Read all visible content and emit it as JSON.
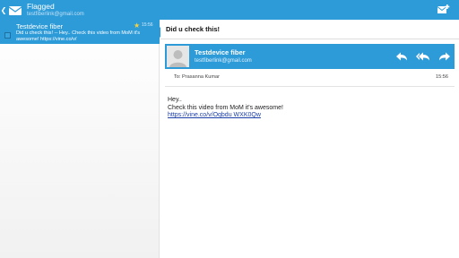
{
  "appbar": {
    "folder_title": "Flagged",
    "account_email": "testfiberlink@gmail.com",
    "back_icon": "chevron-left-icon",
    "app_icon": "envelope-icon",
    "compose_icon": "compose-mail-icon"
  },
  "message_list": {
    "items": [
      {
        "sender": "Testdevice fiber",
        "time": "15:56",
        "flagged": true,
        "snippet": "Did u check this! -- Hey.. Check this video from MoM it's awesome! https://vine.co/v/"
      }
    ]
  },
  "reader": {
    "subject": "Did u check this!",
    "sender_name": "Testdevice fiber",
    "sender_email": "testfiberlink@gmail.com",
    "actions": [
      "reply-icon",
      "reply-all-icon",
      "forward-icon"
    ],
    "to_label": "To:",
    "to_name": "Prasanna Kumar",
    "time": "15:56",
    "body": {
      "line1": "Hey..",
      "line2": "Check this video from MoM it's awesome!",
      "link": "https://vine.co/v/Oqbdu WXK0Qw"
    }
  },
  "colors": {
    "accent": "#2e9bd9",
    "star": "#f7d23c",
    "link": "#1a3ea8"
  }
}
